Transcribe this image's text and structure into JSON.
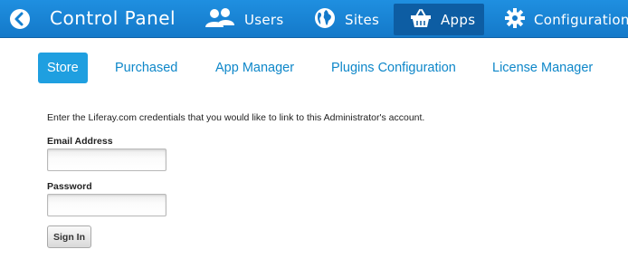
{
  "header": {
    "title": "Control Panel",
    "back_icon": "back-arrow-icon",
    "nav": [
      {
        "label": "Users",
        "icon": "users-icon"
      },
      {
        "label": "Sites",
        "icon": "globe-icon"
      },
      {
        "label": "Apps",
        "icon": "basket-icon",
        "active": true
      },
      {
        "label": "Configuration",
        "icon": "gear-icon"
      }
    ]
  },
  "subnav": {
    "tabs": [
      {
        "label": "Store",
        "active": true
      },
      {
        "label": "Purchased"
      },
      {
        "label": "App Manager"
      },
      {
        "label": "Plugins Configuration"
      },
      {
        "label": "License Manager"
      }
    ]
  },
  "form": {
    "intro": "Enter the Liferay.com credentials that you would like to link to this Administrator's account.",
    "email_label": "Email Address",
    "email_value": "",
    "password_label": "Password",
    "password_value": "",
    "submit_label": "Sign In"
  },
  "colors": {
    "topbar": "#1479c9",
    "active_nav": "#0d5da3",
    "link": "#0e87c9",
    "active_tab": "#1f9fe0"
  }
}
